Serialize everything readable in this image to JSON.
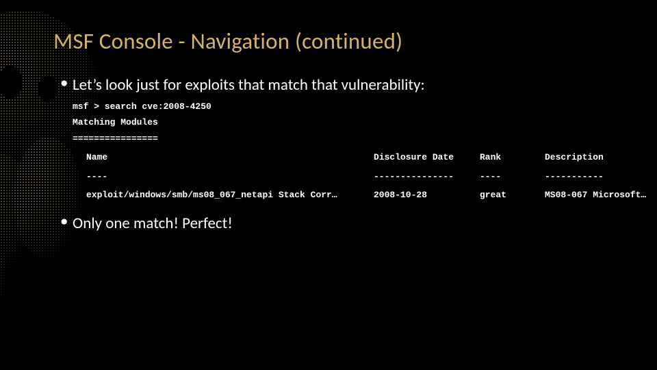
{
  "title": "MSF Console - Navigation (continued)",
  "bullet1": "Let’s look just for exploits that match that vulnerability:",
  "bullet2": "Only one match!  Perfect!",
  "terminal": {
    "cmd": "msf > search cve:2008-4250",
    "header": "Matching Modules",
    "divider": "================",
    "columns": {
      "name": "Name",
      "date": "Disclosure Date",
      "rank": "Rank",
      "desc": "Description"
    },
    "col_dashes": {
      "name": "----",
      "date": "---------------",
      "rank": "----",
      "desc": "-----------"
    },
    "row": {
      "name": "exploit/windows/smb/ms08_067_netapi Stack Corr…",
      "date": "2008-10-28",
      "rank": "great",
      "desc": "MS08-067 Microsoft…"
    }
  }
}
